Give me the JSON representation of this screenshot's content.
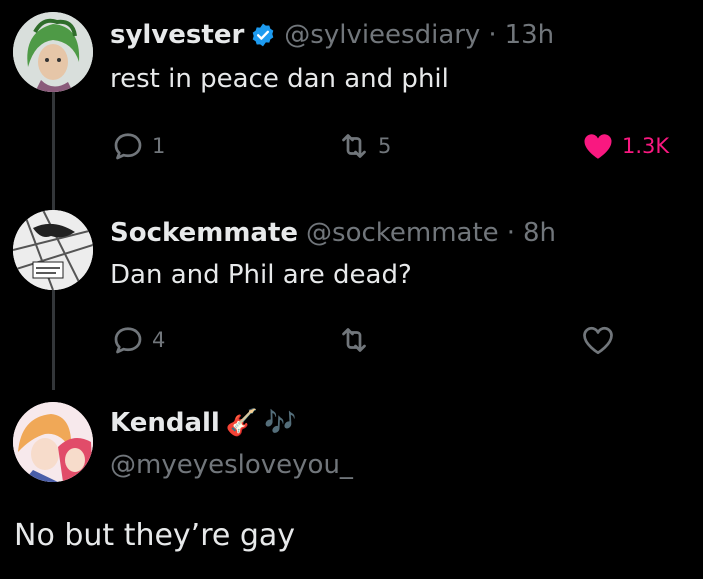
{
  "tweets": [
    {
      "name": "sylvester",
      "handle": "@sylvieesdiary",
      "time": "13h",
      "text": "rest in peace dan and phil",
      "verified": true,
      "replies": "1",
      "reposts": "5",
      "likes": "1.3K",
      "liked": true,
      "avatar_icon": "avatar-green-hair-icon"
    },
    {
      "name": "Sockemmate",
      "handle": "@sockemmate",
      "time": "8h",
      "text": "Dan and Phil are dead?",
      "verified": false,
      "replies": "4",
      "reposts": "",
      "likes": "",
      "liked": false,
      "avatar_icon": "avatar-manga-icon"
    }
  ],
  "main_post": {
    "name": "Kendall",
    "emoji_1": "🎸",
    "emoji_2": "🎶",
    "handle": "@myeyesloveyou_",
    "text": "No but they’re gay",
    "avatar_icon": "avatar-anime-icon"
  },
  "colors": {
    "background": "#000000",
    "text": "#e7e9ea",
    "muted": "#71767b",
    "like": "#f91880",
    "verified": "#1d9bf0",
    "thread_line": "#333639"
  }
}
